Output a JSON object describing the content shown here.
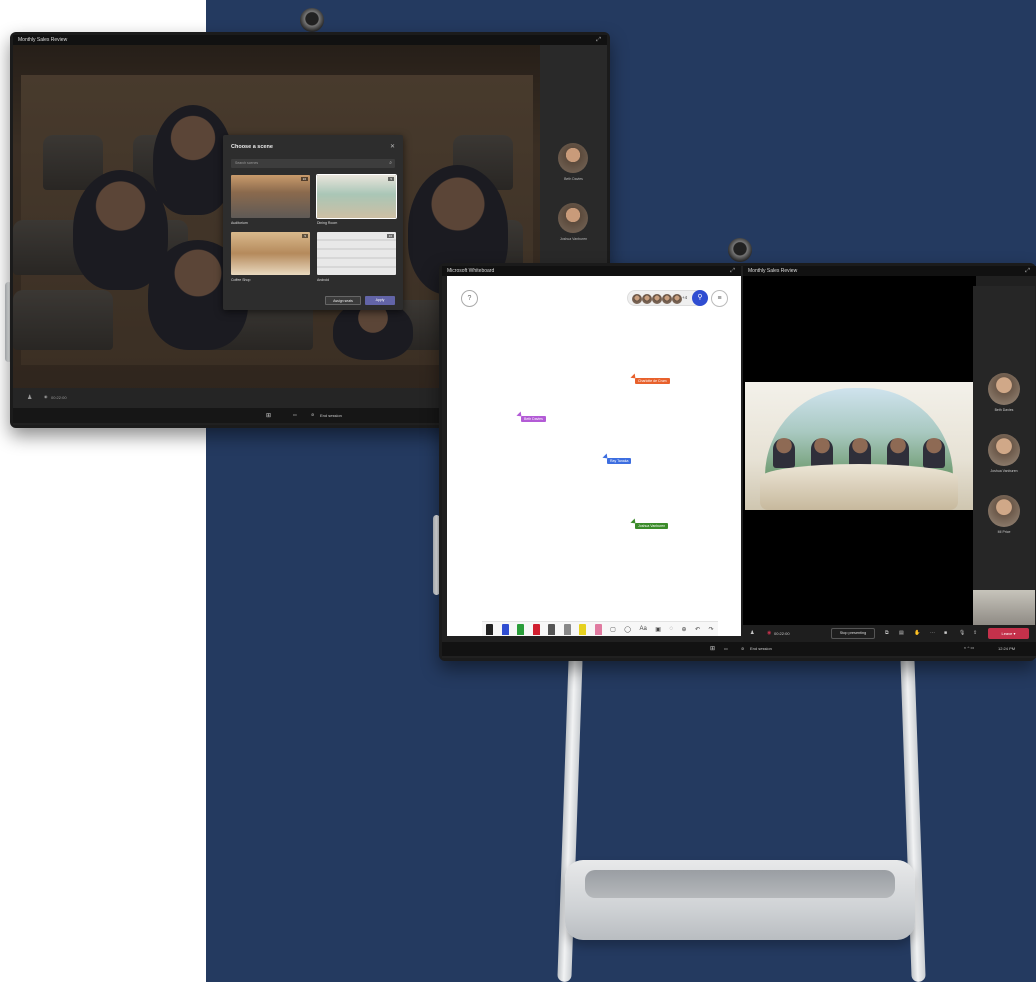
{
  "left_device": {
    "title": "Monthly Sales Review",
    "timer": "00:22:00",
    "end_session": "End session",
    "participants": [
      {
        "name": "Beth Davies"
      },
      {
        "name": "Joshua Vanburen"
      }
    ],
    "scene_dialog": {
      "title": "Choose a scene",
      "search_placeholder": "Search scenes",
      "scenes": [
        {
          "label": "Auditorium",
          "badge": "16"
        },
        {
          "label": "Dining Room",
          "badge": "5"
        },
        {
          "label": "Coffee Shop",
          "badge": "5"
        },
        {
          "label": "Android",
          "badge": "16"
        }
      ],
      "assign_seats": "Assign seats",
      "apply": "Apply"
    }
  },
  "right_device": {
    "whiteboard_title": "Microsoft Whiteboard",
    "meeting_title": "Monthly Sales Review",
    "people_extra": "+4",
    "cursors": [
      {
        "name": "Charlotte de Crum",
        "color": "#e8612c"
      },
      {
        "name": "Beth Davies",
        "color": "#b35bd6"
      },
      {
        "name": "Ray Tanaka",
        "color": "#3d6ee0"
      },
      {
        "name": "Joshua Vanburen",
        "color": "#3b8c2a"
      }
    ],
    "participants": [
      {
        "name": "Beth Davies"
      },
      {
        "name": "Joshua Vanburen"
      },
      {
        "name": "MI Price"
      }
    ],
    "timer": "00:22:00",
    "stop_presenting": "Stop presenting",
    "leave": "Leave",
    "end_session": "End session",
    "clock": "12:24 PM",
    "pen_colors": [
      "#222222",
      "#2f4dd1",
      "#2a9d3a",
      "#d11f2f",
      "#555555",
      "#888888",
      "#e6d11f",
      "#e07aa0"
    ]
  }
}
